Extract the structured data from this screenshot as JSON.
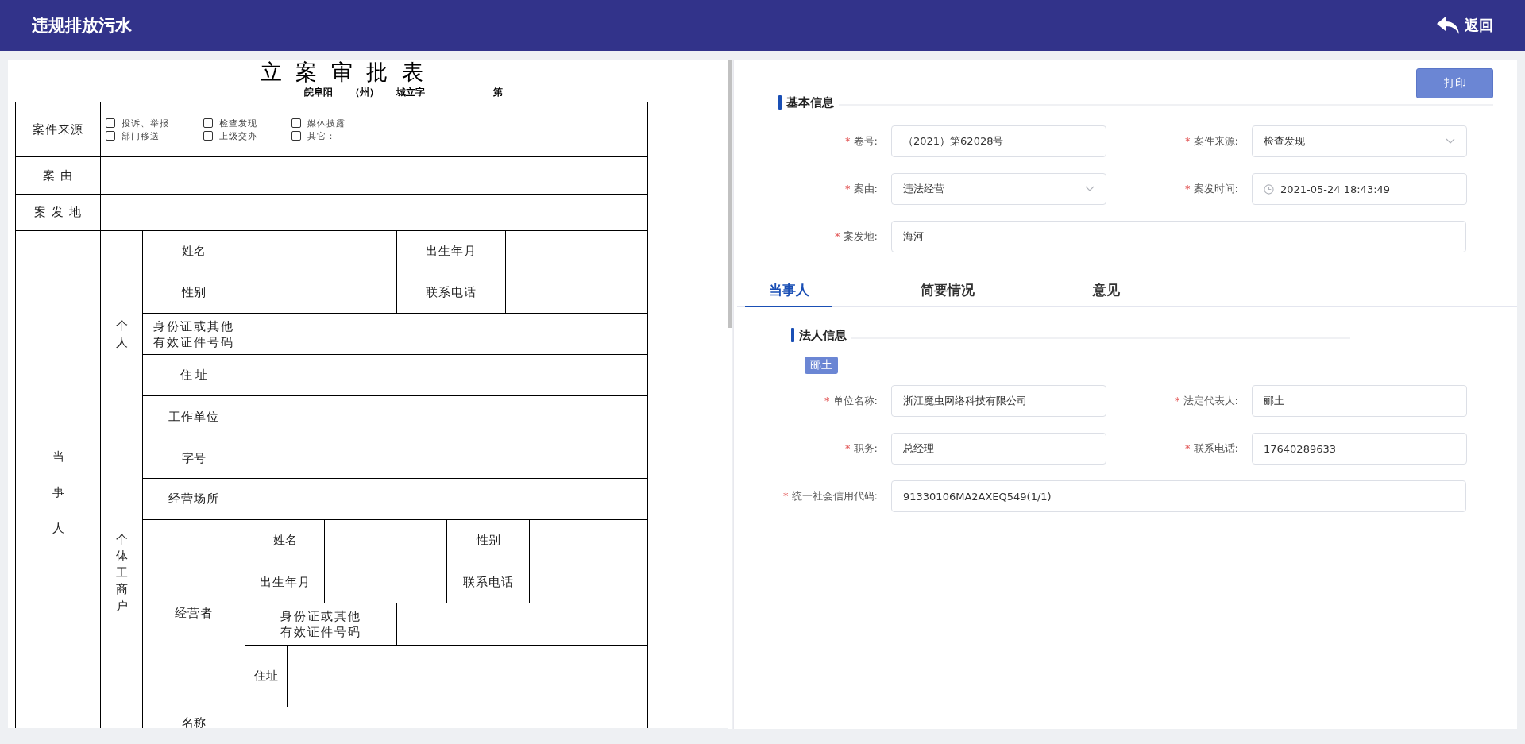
{
  "app_bar": {
    "title": "违规排放污水",
    "back_button": "返回"
  },
  "document": {
    "title": "立案审批表",
    "number_line": [
      "皖阜阳",
      "（州）",
      "城立字",
      "第"
    ],
    "case_source": {
      "label": "案件来源",
      "options": [
        {
          "label": "投诉、举报",
          "checked": false
        },
        {
          "label": "检查发现",
          "checked": false
        },
        {
          "label": "媒体披露",
          "checked": false
        },
        {
          "label": "部门移送",
          "checked": false
        },
        {
          "label": "上级交办",
          "checked": false
        },
        {
          "label": "其它：______",
          "checked": false
        }
      ]
    },
    "case_cause_label": "案 由",
    "case_location_label": "案 发 地",
    "party_label": "当事人",
    "individual": {
      "label": "个人",
      "fields": [
        "姓名",
        "出生年月",
        "性别",
        "联系电话",
        "身份证或其他有效证件号码",
        "住 址",
        "工作单位"
      ]
    },
    "business": {
      "label": "个体工商户",
      "fields": [
        "字号",
        "经营场所"
      ],
      "operator": {
        "label": "经营者",
        "fields": [
          "姓名",
          "性别",
          "出生年月",
          "联系电话",
          "身份证或其他有效证件号码",
          "住址"
        ]
      }
    },
    "unit": {
      "fields": [
        "名称"
      ]
    }
  },
  "print_button": "打印",
  "basic_info": {
    "title": "基本信息",
    "fields": [
      {
        "marker": "*",
        "label": "卷号:",
        "value": "（2021）第62028号",
        "kind": "text"
      },
      {
        "marker": "*",
        "label": "案件来源:",
        "value": "检查发现",
        "kind": "select"
      },
      {
        "marker": "*",
        "label": "案由:",
        "value": "违法经营",
        "kind": "select"
      },
      {
        "marker": "*",
        "label": "案发时间:",
        "value": "2021-05-24 18:43:49",
        "kind": "datetime"
      },
      {
        "marker": "*",
        "label": "案发地:",
        "value": "海河",
        "kind": "wide"
      }
    ]
  },
  "tabs": [
    {
      "label": "当事人",
      "selected": true
    },
    {
      "label": "简要情况",
      "selected": false
    },
    {
      "label": "意见",
      "selected": false
    }
  ],
  "legal_person": {
    "title": "法人信息",
    "tag": "郦土",
    "fields": [
      {
        "marker": "*",
        "label": "单位名称:",
        "value": "浙江魔虫网络科技有限公司",
        "kind": "text"
      },
      {
        "marker": "*",
        "label": "法定代表人:",
        "value": "郦土",
        "kind": "text"
      },
      {
        "marker": "*",
        "label": "职务:",
        "value": "总经理",
        "kind": "text"
      },
      {
        "marker": "*",
        "label": "联系电话:",
        "value": "17640289633",
        "kind": "text"
      },
      {
        "marker": "*",
        "label": "统一社会信用代码:",
        "value": "91330106MA2AXEQ549(1/1)",
        "kind": "wide"
      }
    ]
  }
}
